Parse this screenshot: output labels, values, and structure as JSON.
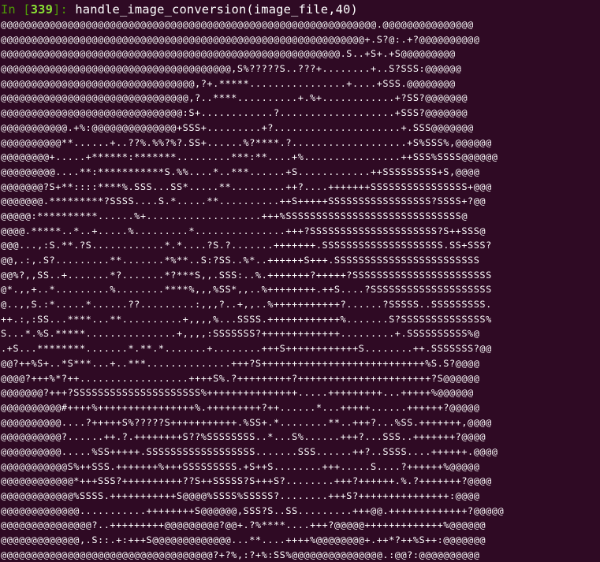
{
  "prompt": {
    "in_label": "In [",
    "number": "339",
    "close_label": "]: ",
    "command": "handle_image_conversion(image_file,40)"
  },
  "output": {
    "rows": [
      "@@@@@@@@@@@@@@@@@@@@@@@@@@@@@@@@@@@@@@@@@@@@@@@@@@@@@@@@@@@@@@.@@@@@@@@@@@@@@@",
      "@@@@@@@@@@@@@@@@@@@@@@@@@@@@@@@@@@@@@@@@@@@@@@@@@@@@@@@@@@@@+.S?@:.+?@@@@@@@@@@",
      "@@@@@@@@@@@@@@@@@@@@@@@@@@@@@@@@@@@@@@@@@@@@@@@@@@@@@@@@.S..+S+.+S@@@@@@@@@",
      "@@@@@@@@@@@@@@@@@@@@@@@@@@@@@@@@@@@@@@,S%?????S..???+........+..S?SSS:@@@@@@",
      "@@@@@@@@@@@@@@@@@@@@@@@@@@@@@@@@,?+.*****................+....+SSS.@@@@@@@@",
      "@@@@@@@@@@@@@@@@@@@@@@@@@@@@@@@,?..****..........+.%+............+?SS?@@@@@@@",
      "@@@@@@@@@@@@@@@@@@@@@@@@@@@@@@:S+............?...................+SSS?@@@@@@@",
      "@@@@@@@@@@@.+%:@@@@@@@@@@@@@@+SSS+.........+?.....................+.SSS@@@@@@@",
      "@@@@@@@@@@**......+..??%.%%?%?.SS+......%?****.?...................+S%SSS%,@@@@@@",
      "@@@@@@@@+.....+******:*******.........***:**....+%................++SSS%SSSS@@@@@@",
      "@@@@@@@@@....**:***********S.%%....*..***......+S............++SSSSSSSSS+S,@@@@",
      "@@@@@@@?S+**::::****%.SSS...SS*.....**.........++?....+++++++SSSSSSSSSSSSSSSS+@@@",
      "@@@@@@@.*********?SSSS....S.*.....**..........++S+++++SSSSSSSSSSSSSSSSS?SSSS+?@@",
      "@@@@@:**********......%+...................+++%SSSSSSSSSSSSSSSSSSSSSSSSSSSSS@",
      "@@@@.*****..*..+.....%.........*...............+++?SSSSSSSSSSSSSSSSSSSSS?S++SSS@",
      "@@@...,:S.**.?S............*.*....?S.?.......+++++++.SSSSSSSSSSSSSSSSSSSS.SS+SSS?",
      "@@,.:,.S?.........**.......*%**..S:?SS..%*..++++++S+++.SSSSSSSSSSSSSSSSSSSSSSSS",
      "@@%?,,SS..+.......*?.......*?***S,,.SSS:..%.+++++++?+++++?SSSSSSSSSSSSSSSSSSSSSSS",
      "@*.,,+..*.........%........****%,,,%SS*,,..%++++++++.++S....?SSSSSSSSSSSSSSSSSSSS",
      "@..,,S.:*.....*......??.........:,,,?..+,,..%+++++++++++?......?SSSSS..SSSSSSSSS.",
      "++.:,:SS...****...**..........+,,,,%...SSSS.++++++++++++%.......S?SSSSSSSSSSSSSS%",
      "S...*.%S.*****...............+,,,,:SSSSSSS?+++++++++++++.........+.SSSSSSSSSS%@",
      ".+S...********.......*.**.*.......+........+++S++++++++++++S........++.SSSSSSS?@@",
      "@@?++%S+..*S***...+..***..............+++?S+++++++++++++++++++++++++++%S.S?@@@@",
      "@@@@?+++%*?++..................++++S%.?+++++++++?++++++++++++++++++++++?S@@@@@@",
      "@@@@@@@?+++?SSSSSSSSSSSSSSSSSSSSS%+++++++++++++++.....+++++++++...+++++%@@@@@@",
      "@@@@@@@@@@#++++%++++++++++++++++%.+++++++++?++......*...+++++......++++++?@@@@@",
      "@@@@@@@@@@....?+++++S%?????S+++++++++++.%SS+.*........**..+++?...%SS.+++++++,@@@@",
      "@@@@@@@@@@?......++.?.++++++++S??%SSSSSSSS..*...S%......+++?...SSS..+++++++?@@@@",
      "@@@@@@@@@@.....%SS+++++.SSSSSSSSSSSSSSSSSS.......SSS......++?..SSSS....++++++.@@@@",
      "@@@@@@@@@@@S%++SSS.+++++++%+++SSSSSSSSS.+S++S........+++.....S....?++++++%@@@@@",
      "@@@@@@@@@@@@*+++SSS?++++++++++??S++SSSSS?S+++S?........+++?++++++.%.?+++++++?@@@@",
      "@@@@@@@@@@@@%SSSS.+++++++++++S@@@@%SSSS%SSSSS?........+++S?+++++++++++++++:@@@@",
      "@@@@@@@@@@@@@...........++++++++S@@@@@@,SSS?S..SS.........+++@@.+++++++++++++?@@@@@",
      "@@@@@@@@@@@@@@@?..+++++++++@@@@@@@@@?@@+.?%****....+++?@@@@@+++++++++++++%@@@@@@",
      "@@@@@@@@@@@@@,.S::.+:+++S@@@@@@@@@@@@@...**....++++%@@@@@@@@+.++*?++%S++:@@@@@@@",
      "@@@@@@@@@@@@@@@@@@@@@@@@@@@@@@@@@@@?+?%,:?+%:SS%@@@@@@@@@@@@@@@.:@@?:@@@@@@@@@@"
    ]
  }
}
